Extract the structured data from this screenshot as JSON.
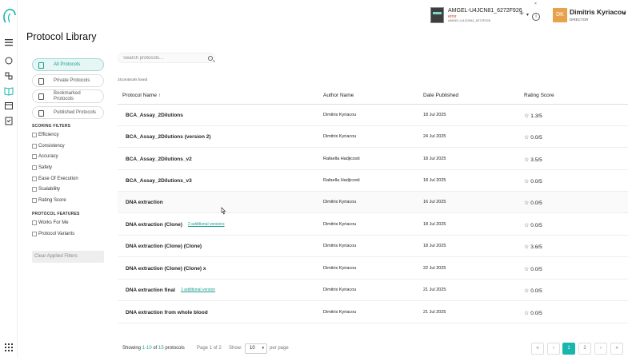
{
  "header": {
    "instrument_name": "AMGEL-U4JCN81_6272F926",
    "instrument_status": "error",
    "instrument_sub": "AMGEL-U4JCN81_6272F926",
    "user_initials": "DK",
    "user_name": "Dimitris Kyriacou",
    "user_role": "DIRECTOR"
  },
  "page_title": "Protocol Library",
  "nav": [
    {
      "label": "All Protocols",
      "active": true
    },
    {
      "label": "Private Protocols",
      "active": false
    },
    {
      "label": "Bookmarked Protocols",
      "active": false
    },
    {
      "label": "Published Protocols",
      "active": false
    }
  ],
  "filters": {
    "scoring_title": "SCORING FILTERS",
    "scoring": [
      "Efficiency",
      "Consistency",
      "Accuracy",
      "Safety",
      "Ease Of Execution",
      "Scalability",
      "Rating Score"
    ],
    "features_title": "PROTOCOL FEATURES",
    "features": [
      "Works For Me",
      "Protocol Variants"
    ],
    "clear_label": "Clear Applied Filters"
  },
  "search": {
    "placeholder": "Search protocols..."
  },
  "found_text": "15 protocols found",
  "columns": {
    "name": "Protocol Name ↑",
    "author": "Author Name",
    "date": "Date Published",
    "score": "Rating Score"
  },
  "rows": [
    {
      "name": "BCA_Assay_2Dilutions",
      "extra": "",
      "author": "Dimitris Kyriacou",
      "date": "18 Jul 2025",
      "score": "1.3/5"
    },
    {
      "name": "BCA_Assay_2Dilutions (version 2)",
      "extra": "",
      "author": "Dimitris Kyriacou",
      "date": "24 Jul 2025",
      "score": "0.0/5"
    },
    {
      "name": "BCA_Assay_2Dilutions_v2",
      "extra": "",
      "author": "Rafaella Hadjicosti",
      "date": "18 Jul 2025",
      "score": "3.5/5"
    },
    {
      "name": "BCA_Assay_2Dilutions_v3",
      "extra": "",
      "author": "Rafaella Hadjicosti",
      "date": "18 Jul 2025",
      "score": "0.0/5"
    },
    {
      "name": "DNA extraction",
      "extra": "",
      "author": "Dimitris Kyriacou",
      "date": "16 Jul 2025",
      "score": "0.0/5"
    },
    {
      "name": "DNA extraction (Clone)",
      "extra": "2 additional versions",
      "author": "Dimitris Kyriacou",
      "date": "18 Jul 2025",
      "score": "0.0/5"
    },
    {
      "name": "DNA extraction (Clone) (Clone)",
      "extra": "",
      "author": "Dimitris Kyriacou",
      "date": "18 Jul 2025",
      "score": "3.6/5"
    },
    {
      "name": "DNA extraction (Clone) (Clone) x",
      "extra": "",
      "author": "Dimitris Kyriacou",
      "date": "22 Jul 2025",
      "score": "0.0/5"
    },
    {
      "name": "DNA extraction final",
      "extra": "1 additional version",
      "author": "Dimitris Kyriacou",
      "date": "21 Jul 2025",
      "score": "0.0/5"
    },
    {
      "name": "DNA extraction from whole blood",
      "extra": "",
      "author": "Dimitris Kyriacou",
      "date": "21 Jul 2025",
      "score": "0.0/5"
    }
  ],
  "footer": {
    "showing_prefix": "Showing ",
    "showing_range": "1-10",
    "showing_of": " of ",
    "showing_total": "15",
    "showing_suffix": " protocols",
    "page_info": "Page 1 of 2",
    "show_label": "Show:",
    "per_page_value": "10",
    "per_page_label": "per page",
    "pages": [
      "«",
      "‹",
      "1",
      "2",
      "›",
      "»"
    ]
  }
}
